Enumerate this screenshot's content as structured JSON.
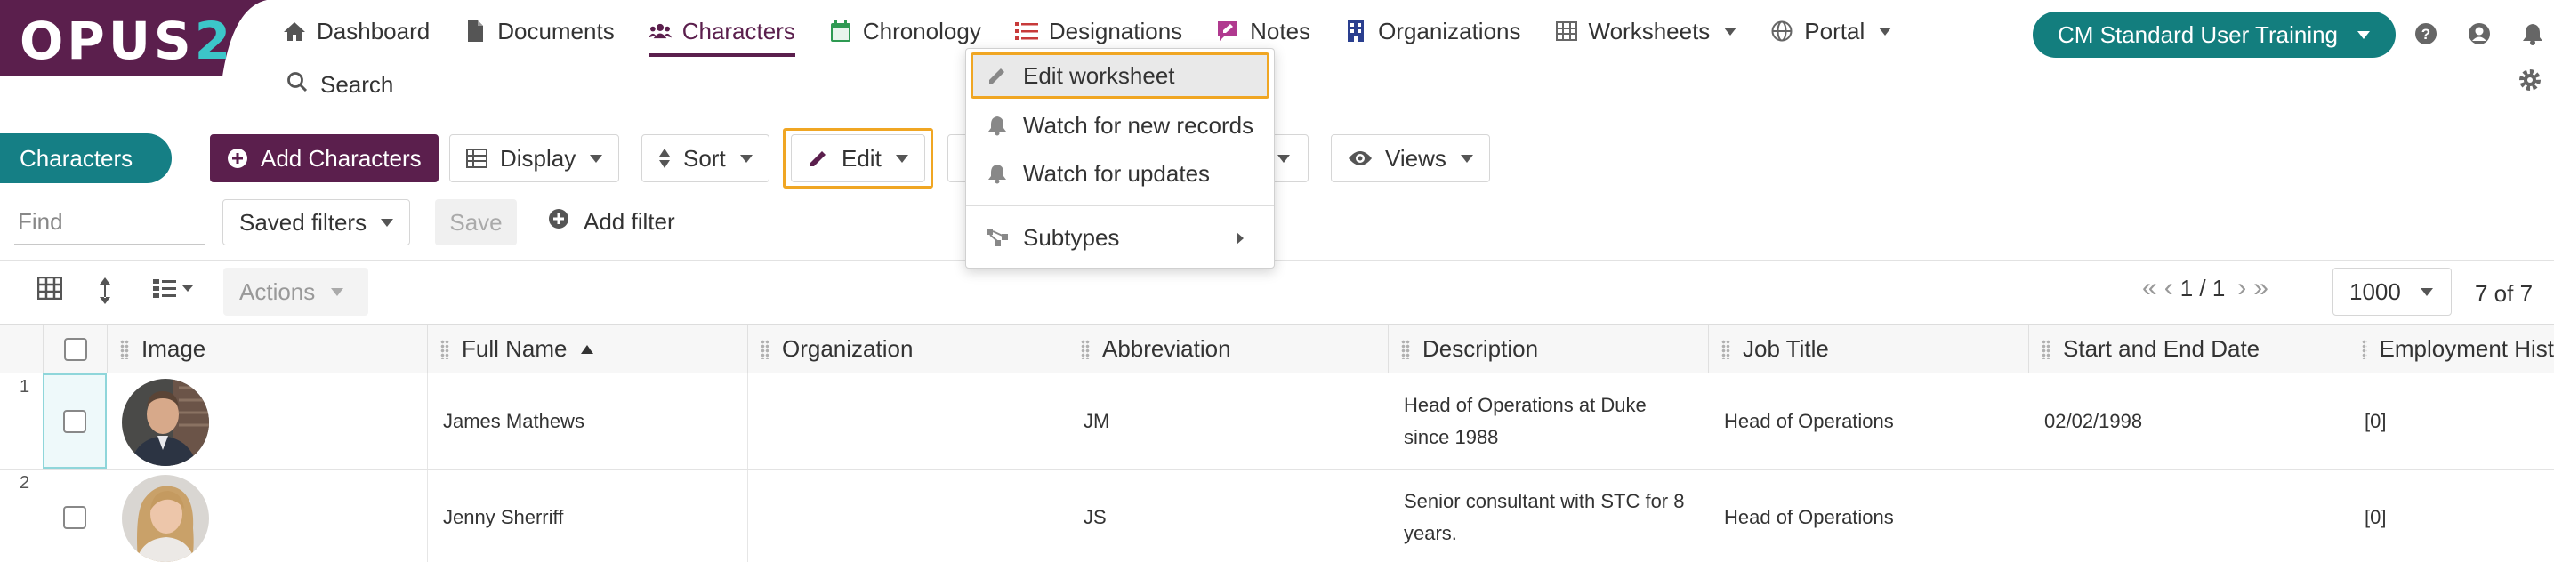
{
  "logo": {
    "part1": "OPUS",
    "part2": "2"
  },
  "nav": {
    "items": [
      {
        "label": "Dashboard",
        "icon": "home-icon"
      },
      {
        "label": "Documents",
        "icon": "document-icon"
      },
      {
        "label": "Characters",
        "icon": "users-icon",
        "active": true
      },
      {
        "label": "Chronology",
        "icon": "calendar-icon"
      },
      {
        "label": "Designations",
        "icon": "list-icon"
      },
      {
        "label": "Notes",
        "icon": "note-icon"
      },
      {
        "label": "Organizations",
        "icon": "building-icon"
      },
      {
        "label": "Worksheets",
        "icon": "table-icon",
        "dropdown": true
      },
      {
        "label": "Portal",
        "icon": "globe-icon",
        "dropdown": true
      }
    ],
    "search_label": "Search"
  },
  "header": {
    "env_label": "CM Standard User Training"
  },
  "toolbar": {
    "breadcrumb": "Characters",
    "add_label": "Add Characters",
    "display_label": "Display",
    "sort_label": "Sort",
    "edit_label": "Edit",
    "views_label": "Views"
  },
  "filters": {
    "find_placeholder": "Find",
    "saved_filters_label": "Saved filters",
    "save_label": "Save",
    "add_filter_label": "Add filter"
  },
  "gridbar": {
    "actions_label": "Actions",
    "page_info": "1 / 1",
    "page_size": "1000",
    "record_count": "7 of 7"
  },
  "table": {
    "columns": [
      "Image",
      "Full Name",
      "Organization",
      "Abbreviation",
      "Description",
      "Job Title",
      "Start and End Date",
      "Employment Hist"
    ],
    "sorted_column": "Full Name",
    "rows": [
      {
        "num": "1",
        "full_name": "James Mathews",
        "organization": "",
        "abbreviation": "JM",
        "description": "Head of Operations at Duke since 1988",
        "job_title": "Head of Operations",
        "dates": "02/02/1998",
        "employment": "[0]"
      },
      {
        "num": "2",
        "full_name": "Jenny Sherriff",
        "organization": "",
        "abbreviation": "JS",
        "description": "Senior consultant with STC for 8 years.",
        "job_title": "Head of Operations",
        "dates": "",
        "employment": "[0]"
      }
    ]
  },
  "edit_menu": {
    "items": [
      {
        "label": "Edit worksheet",
        "icon": "pencil-icon"
      },
      {
        "label": "Watch for new records",
        "icon": "bell-icon"
      },
      {
        "label": "Watch for updates",
        "icon": "bell-icon"
      },
      {
        "label": "Subtypes",
        "icon": "subtypes-icon"
      }
    ]
  },
  "colors": {
    "brand": "#5b1f4d",
    "teal": "#137e7e",
    "highlight": "#f0a623",
    "logo_accent": "#3cc6c9"
  }
}
